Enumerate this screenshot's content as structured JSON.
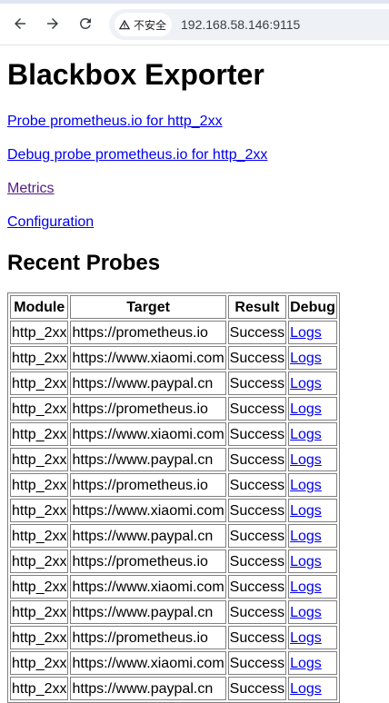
{
  "browser": {
    "back_icon": "arrow-left-icon",
    "forward_icon": "arrow-right-icon",
    "reload_icon": "reload-icon",
    "security_icon": "warning-triangle-icon",
    "security_label": "不安全",
    "url": "192.168.58.146:9115"
  },
  "page": {
    "title": "Blackbox Exporter",
    "links": [
      {
        "label": "Probe prometheus.io for http_2xx",
        "visited": false
      },
      {
        "label": "Debug probe prometheus.io for http_2xx",
        "visited": false
      },
      {
        "label": "Metrics",
        "visited": true
      },
      {
        "label": "Configuration",
        "visited": false
      }
    ],
    "recent_heading": "Recent Probes",
    "table": {
      "headers": [
        "Module",
        "Target",
        "Result",
        "Debug"
      ],
      "rows": [
        [
          "http_2xx",
          "https://prometheus.io",
          "Success",
          "Logs"
        ],
        [
          "http_2xx",
          "https://www.xiaomi.com",
          "Success",
          "Logs"
        ],
        [
          "http_2xx",
          "https://www.paypal.cn",
          "Success",
          "Logs"
        ],
        [
          "http_2xx",
          "https://prometheus.io",
          "Success",
          "Logs"
        ],
        [
          "http_2xx",
          "https://www.xiaomi.com",
          "Success",
          "Logs"
        ],
        [
          "http_2xx",
          "https://www.paypal.cn",
          "Success",
          "Logs"
        ],
        [
          "http_2xx",
          "https://prometheus.io",
          "Success",
          "Logs"
        ],
        [
          "http_2xx",
          "https://www.xiaomi.com",
          "Success",
          "Logs"
        ],
        [
          "http_2xx",
          "https://www.paypal.cn",
          "Success",
          "Logs"
        ],
        [
          "http_2xx",
          "https://prometheus.io",
          "Success",
          "Logs"
        ],
        [
          "http_2xx",
          "https://www.xiaomi.com",
          "Success",
          "Logs"
        ],
        [
          "http_2xx",
          "https://www.paypal.cn",
          "Success",
          "Logs"
        ],
        [
          "http_2xx",
          "https://prometheus.io",
          "Success",
          "Logs"
        ],
        [
          "http_2xx",
          "https://www.xiaomi.com",
          "Success",
          "Logs"
        ],
        [
          "http_2xx",
          "https://www.paypal.cn",
          "Success",
          "Logs"
        ]
      ]
    }
  }
}
